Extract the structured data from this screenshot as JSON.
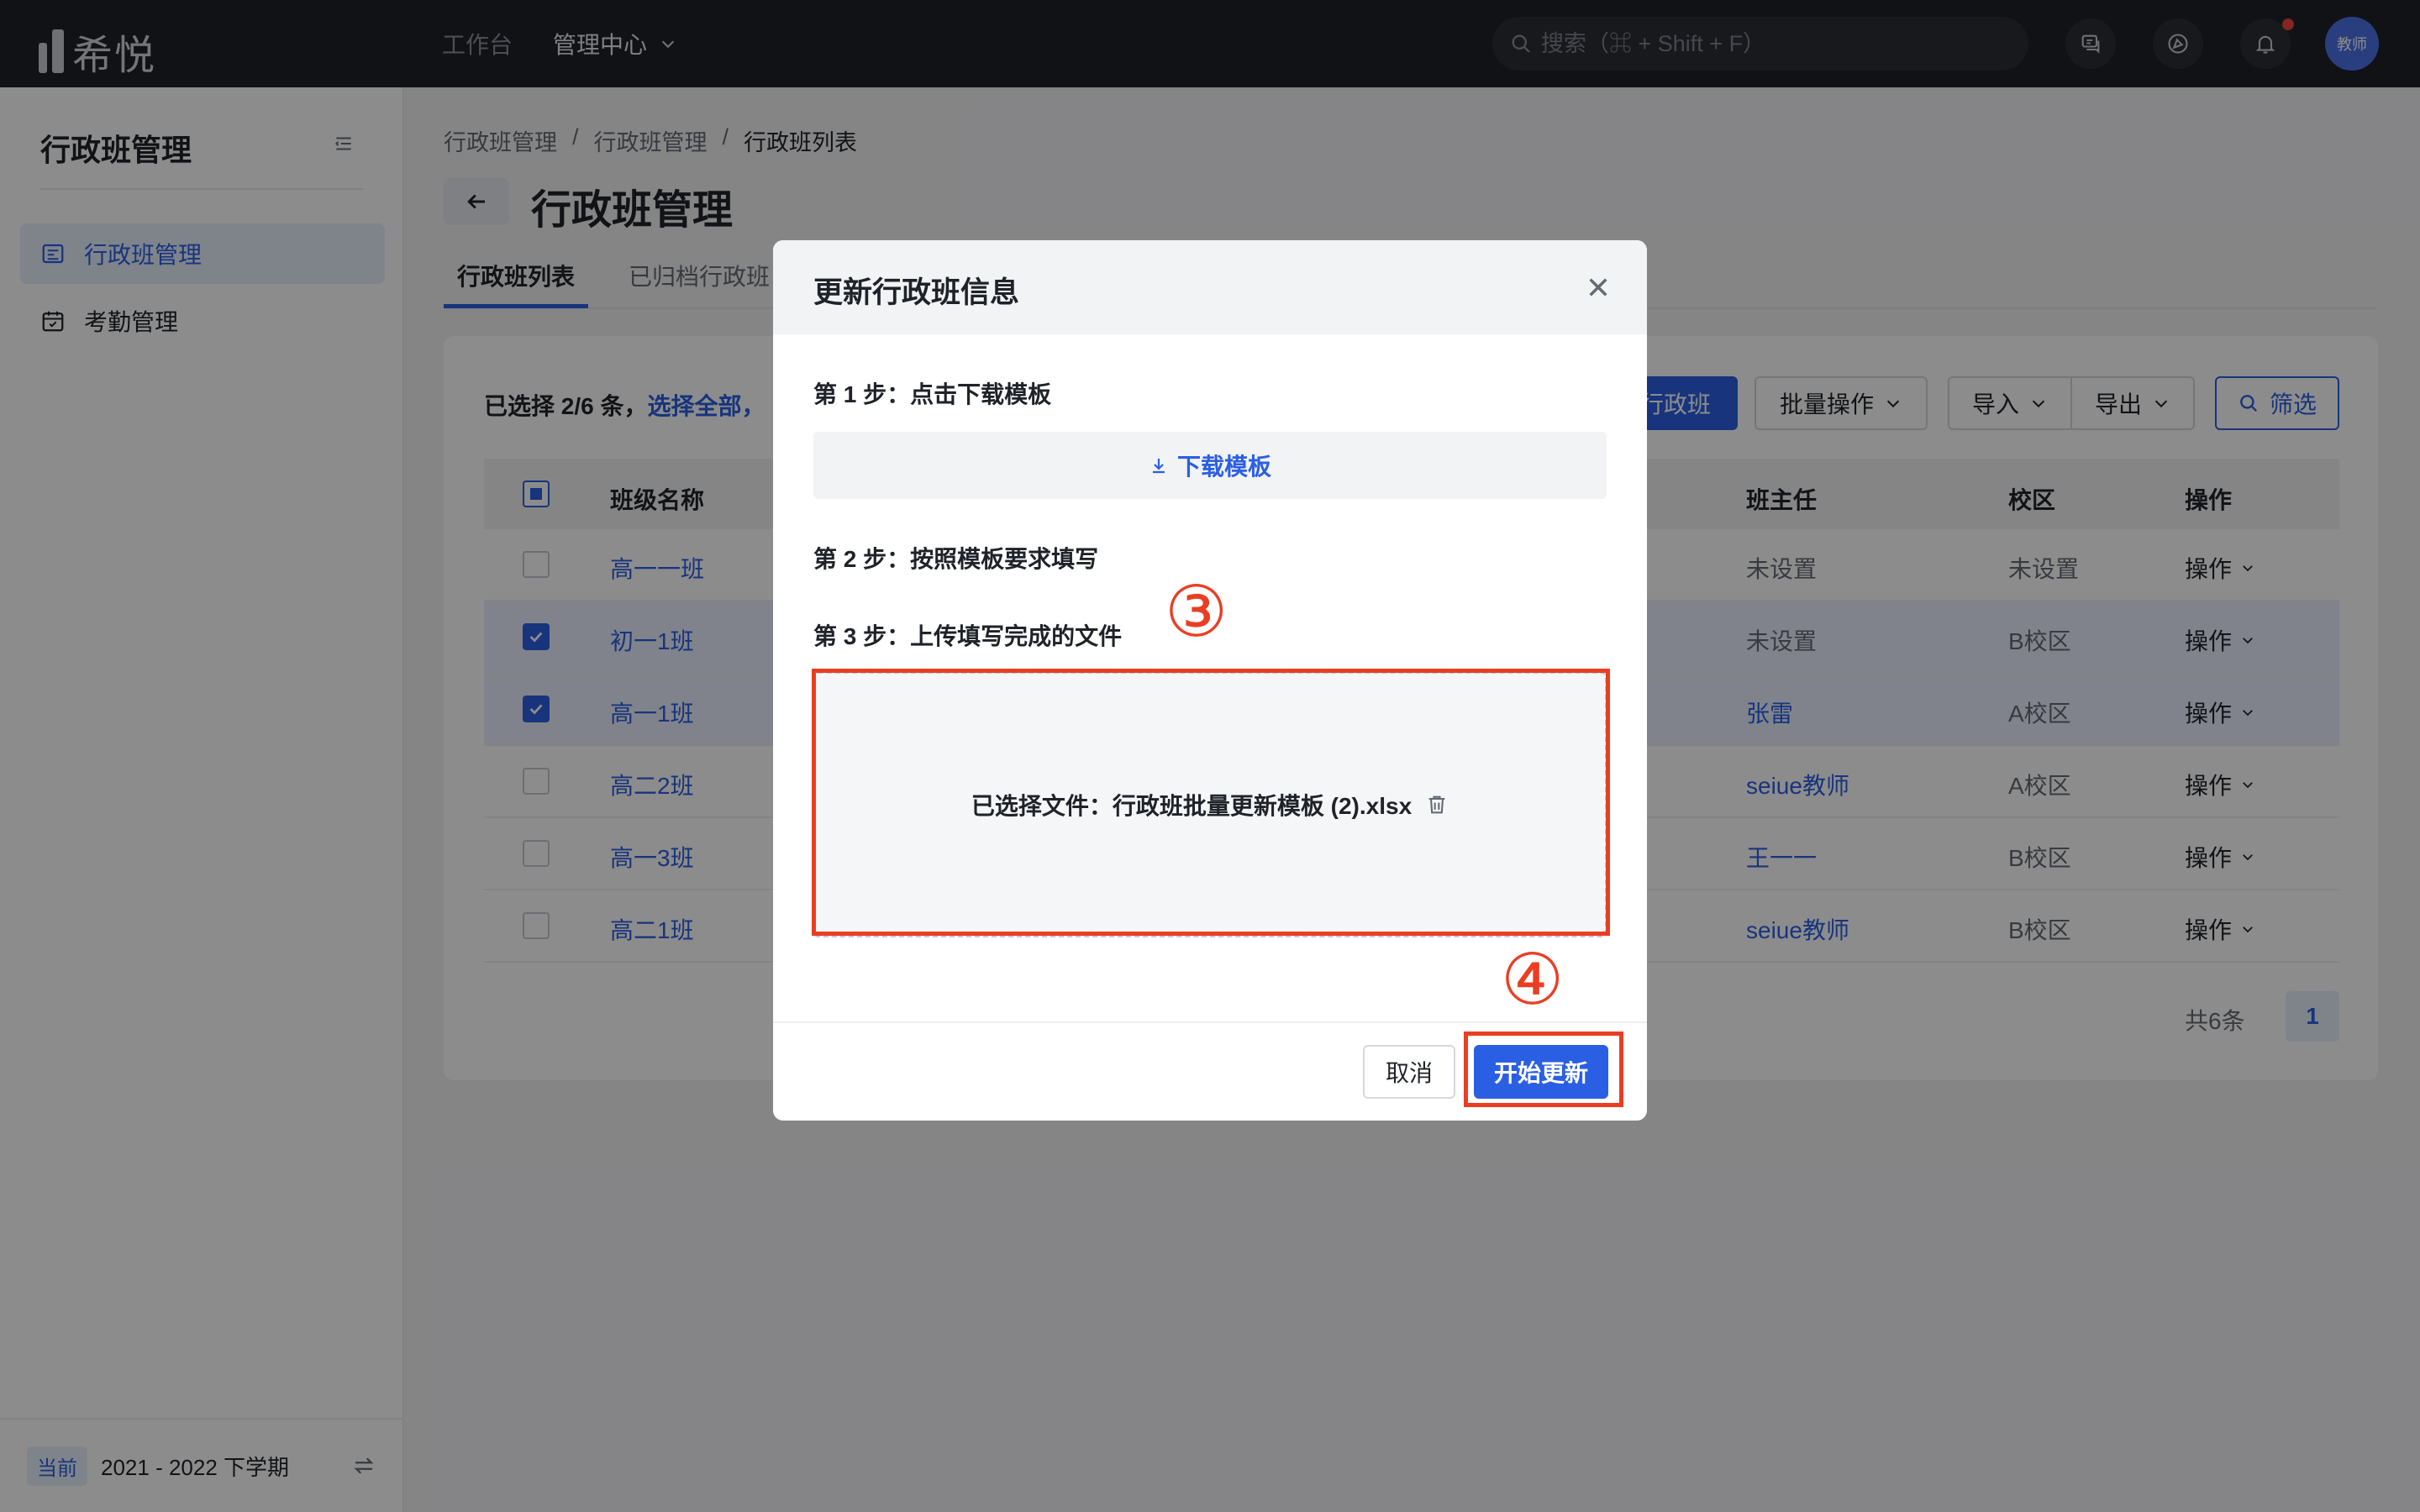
{
  "topbar": {
    "logo_text": "希悦",
    "nav": {
      "workbench": "工作台",
      "admin_center": "管理中心"
    },
    "search_placeholder": "搜索（⌘ + Shift + F）",
    "avatar_text": "教师"
  },
  "sidebar": {
    "title": "行政班管理",
    "items": [
      {
        "label": "行政班管理",
        "icon": "class-list-icon",
        "active": true
      },
      {
        "label": "考勤管理",
        "icon": "calendar-check-icon",
        "active": false
      }
    ],
    "footer": {
      "badge": "当前",
      "term": "2021 - 2022 下学期"
    }
  },
  "breadcrumb": [
    "行政班管理",
    "行政班管理",
    "行政班列表"
  ],
  "breadcrumb_sep": "/",
  "page_title": "行政班管理",
  "tabs": [
    "行政班列表",
    "已归档行政班"
  ],
  "toolbar": {
    "selection_text": "已选择 2/6 条，",
    "select_all": "选择全部，",
    "new_class": "行政班",
    "batch": "批量操作",
    "import": "导入",
    "export": "导出",
    "filter": "筛选"
  },
  "table": {
    "headers": {
      "name": "班级名称",
      "teacher": "班主任",
      "campus": "校区",
      "op": "操作"
    },
    "rows": [
      {
        "name": "高一一班",
        "teacher": "未设置",
        "campus": "未设置",
        "op": "操作",
        "checked": false
      },
      {
        "name": "初一1班",
        "teacher": "未设置",
        "campus": "B校区",
        "op": "操作",
        "checked": true
      },
      {
        "name": "高一1班",
        "teacher": "张雷",
        "campus": "A校区",
        "op": "操作",
        "checked": true
      },
      {
        "name": "高二2班",
        "teacher": "seiue教师",
        "campus": "A校区",
        "op": "操作",
        "checked": false
      },
      {
        "name": "高一3班",
        "teacher": "王一一",
        "campus": "B校区",
        "op": "操作",
        "checked": false
      },
      {
        "name": "高二1班",
        "teacher": "seiue教师",
        "campus": "B校区",
        "op": "操作",
        "checked": false
      }
    ],
    "total": "共6条",
    "page": "1"
  },
  "modal": {
    "title": "更新行政班信息",
    "step1": "第 1 步：点击下载模板",
    "download": "下载模板",
    "step2": "第 2 步：按照模板要求填写",
    "step3": "第 3 步：上传填写完成的文件",
    "file_label": "已选择文件：",
    "file_name": "行政班批量更新模板 (2).xlsx",
    "cancel": "取消",
    "start": "开始更新"
  },
  "annotations": {
    "marker_3": "③",
    "marker_4": "④",
    "color": "#ea3e23"
  },
  "colors": {
    "primary": "#2b5fe3",
    "topbar": "#1f2128",
    "annotation": "#ea3e23"
  }
}
